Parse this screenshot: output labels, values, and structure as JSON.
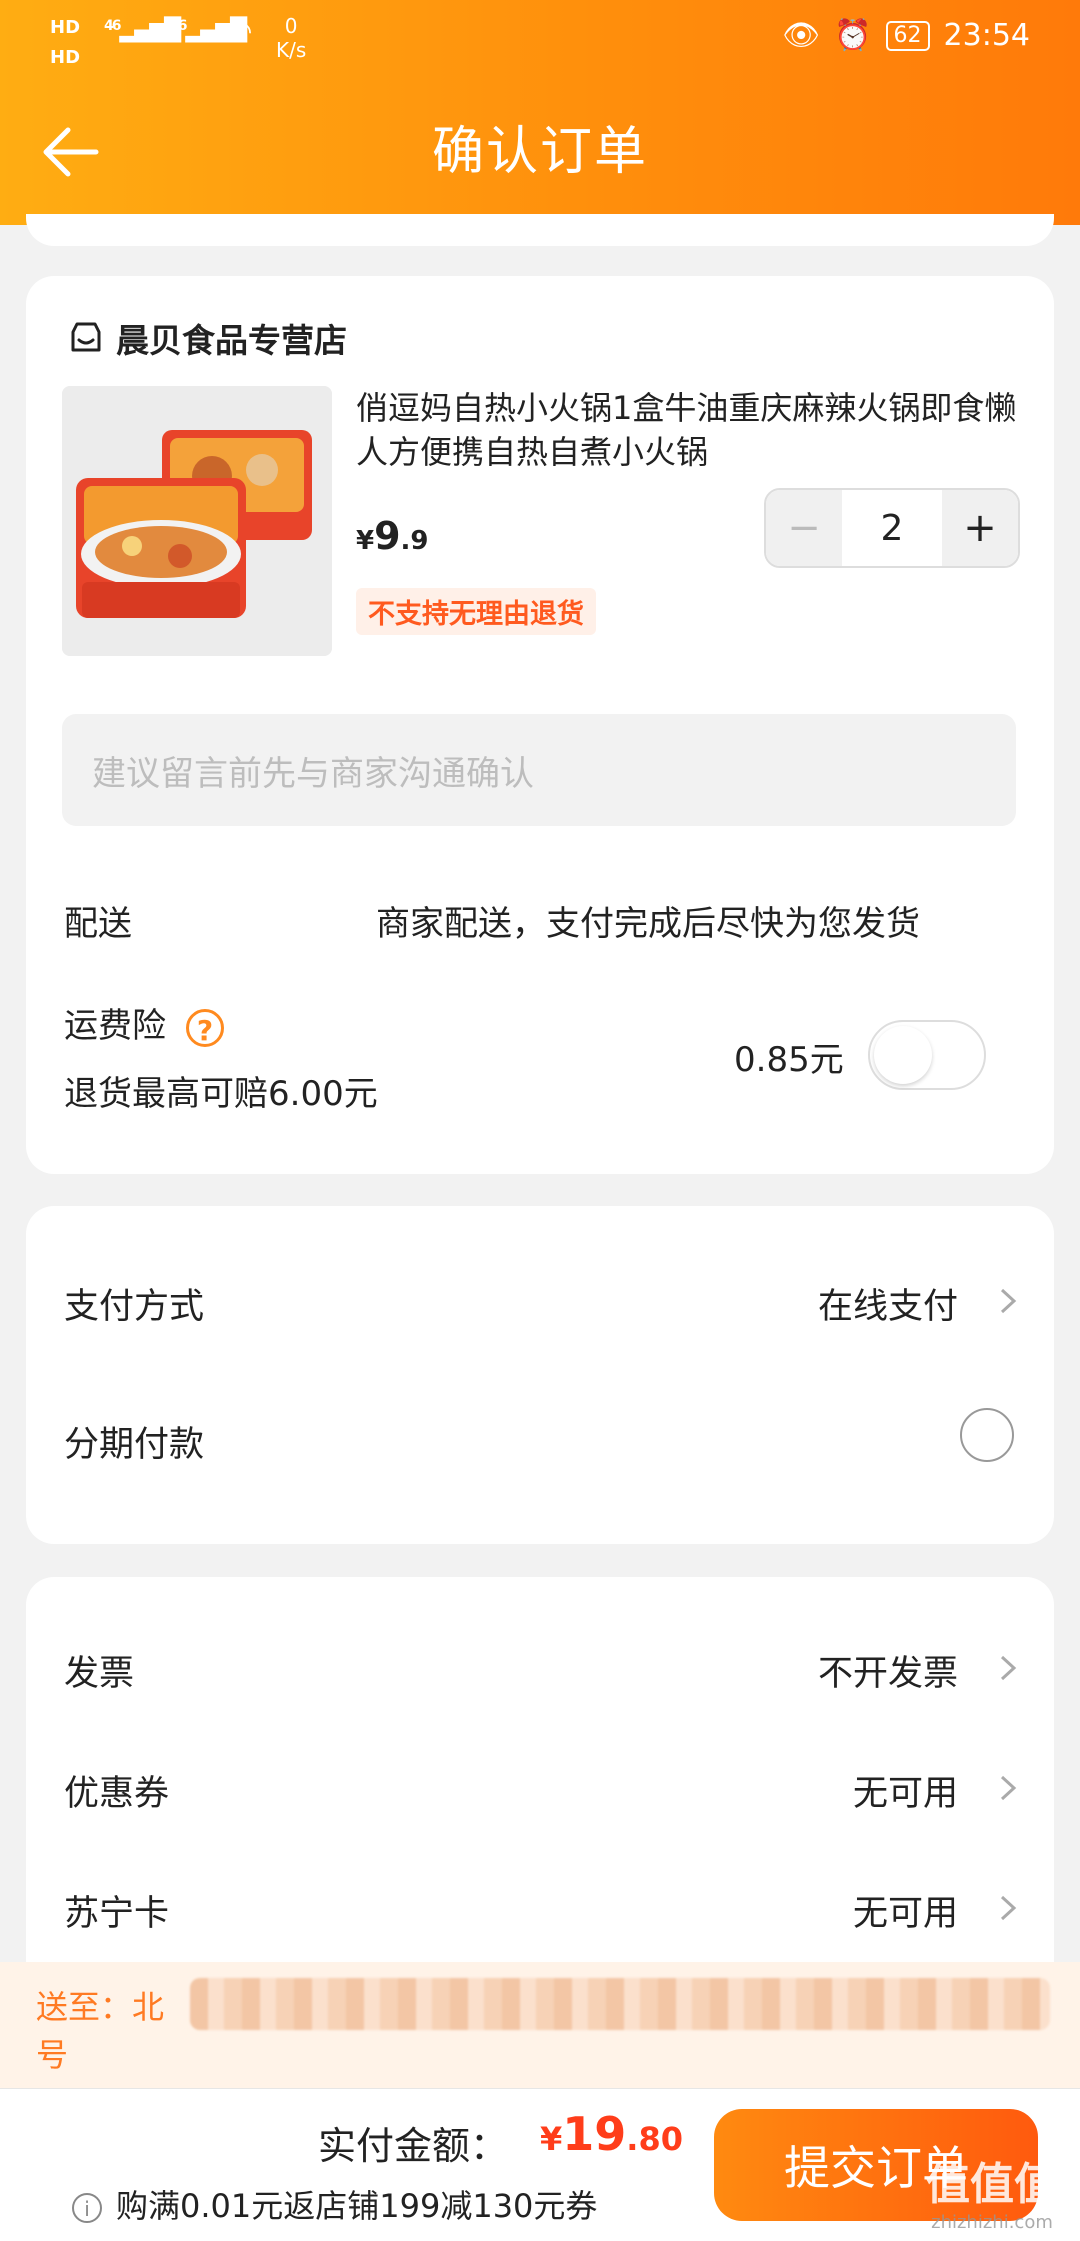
{
  "status_bar": {
    "hd1": "HD",
    "hd2": "HD",
    "net1": "46",
    "net2": "46",
    "speed_value": "0",
    "speed_unit": "K/s",
    "battery": "62",
    "time": "23:54"
  },
  "header": {
    "title": "确认订单"
  },
  "order": {
    "store_name": "晨贝食品专营店",
    "product_title": "俏逗妈自热小火锅1盒牛油重庆麻辣火锅即食懒人方便携自热自煮小火锅",
    "price_symbol": "¥",
    "price_int": "9",
    "price_dec": ".9",
    "quantity": "2",
    "return_tag": "不支持无理由退货",
    "note_placeholder": "建议留言前先与商家沟通确认",
    "delivery_label": "配送",
    "delivery_value": "商家配送，支付完成后尽快为您发货",
    "insurance_label": "运费险",
    "insurance_sub": "退货最高可赔6.00元",
    "insurance_price": "0.85元",
    "insurance_enabled": false
  },
  "payment": {
    "method_label": "支付方式",
    "method_value": "在线支付",
    "installment_label": "分期付款"
  },
  "extras": {
    "invoice_label": "发票",
    "invoice_value": "不开发票",
    "coupon_label": "优惠券",
    "coupon_value": "无可用",
    "card_label": "苏宁卡",
    "card_value": "无可用"
  },
  "address": {
    "prefix": "送至：北",
    "tail": "号"
  },
  "footer": {
    "pay_label": "实付金额：",
    "amount_symbol": "¥",
    "amount_int": "19",
    "amount_dec": ".80",
    "promo": "购满0.01元返店铺199减130元券",
    "submit": "提交订单"
  },
  "watermark": {
    "text": "值值值",
    "url": "zhizhizhi.com"
  },
  "colors": {
    "brand_orange": "#ff8f0c",
    "price_red": "#ff3d1a"
  }
}
